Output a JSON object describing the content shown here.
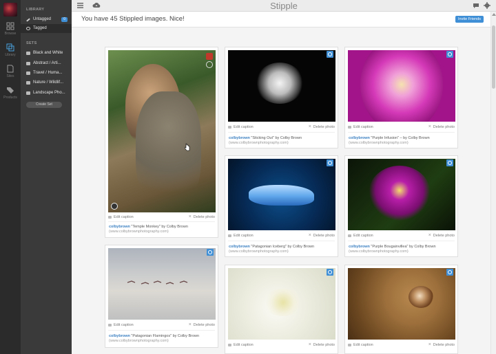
{
  "rail": {
    "items": [
      {
        "label": "Browse",
        "icon": "grid-icon"
      },
      {
        "label": "Library",
        "icon": "library-icon"
      },
      {
        "label": "Sites",
        "icon": "sites-icon"
      },
      {
        "label": "Products",
        "icon": "tag-icon"
      }
    ]
  },
  "sidebar": {
    "library_heading": "LIBRARY",
    "untagged_label": "Untagged",
    "untagged_count": "0",
    "tagged_label": "Tagged",
    "sets_heading": "SETS",
    "sets": [
      "Black and White",
      "Abstract / Arti...",
      "Travel / Huma...",
      "Nature / Wildlif...",
      "Landscape Pho..."
    ],
    "create_set_label": "Create Set"
  },
  "header": {
    "app_title": "Stipple"
  },
  "banner": {
    "message": "You have 45 Stippled images. Nice!",
    "invite_label": "Invite Friends"
  },
  "card_actions": {
    "edit_label": "Edit caption",
    "delete_label": "Delete photo"
  },
  "photos": [
    {
      "user": "colbybrown",
      "title": "\"Temple Monkey\" by Colby Brown",
      "site": "(www.colbybrownphotography.com)"
    },
    {
      "user": "colbybrown",
      "title": "\"Sticking Out\" by Colby Brown",
      "site": "(www.colbybrownphotography.com)"
    },
    {
      "user": "colbybrown",
      "title": "\"Purple Infusion\" – by Colby Brown",
      "site": "(www.colbybrownphotography.com)"
    },
    {
      "user": "colbybrown",
      "title": "\"Patagonian Iceberg\" by Colby Brown",
      "site": "(www.colbybrownphotography.com)"
    },
    {
      "user": "colbybrown",
      "title": "\"Purple Bougainvillea\" by Colby Brown",
      "site": "(www.colbybrownphotography.com)"
    },
    {
      "user": "colbybrown",
      "title": "\"Patagonian Flamingos\" by Colby Brown",
      "site": "(www.colbybrownphotography.com)"
    },
    {
      "user": "",
      "title": "",
      "site": ""
    },
    {
      "user": "",
      "title": "",
      "site": ""
    }
  ],
  "colors": {
    "accent": "#3f8fd6",
    "sidebar_bg": "#3a3a3a",
    "rail_bg": "#2b2b2b"
  }
}
